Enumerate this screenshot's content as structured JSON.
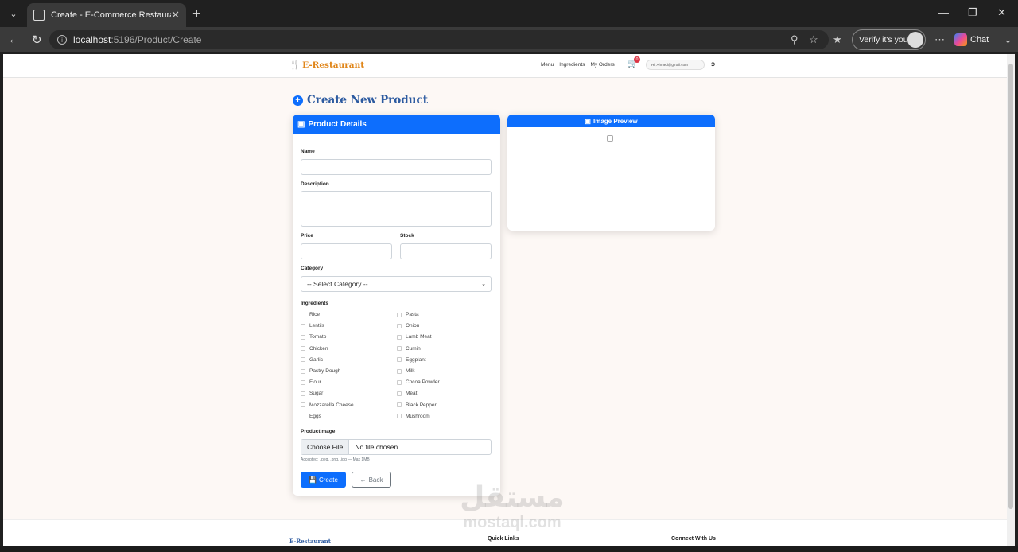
{
  "browser": {
    "tab_title": "Create - E-Commerce Restaurant",
    "url_host": "localhost",
    "url_path": ":5196/Product/Create",
    "verify_label": "Verify it's you",
    "chat_label": "Chat"
  },
  "site": {
    "brand": "E-Restaurant",
    "nav": {
      "menu": "Menu",
      "ingredients": "Ingredients",
      "orders": "My Orders"
    },
    "cart_count": "0",
    "user_greeting": "Hi, Ahmed@gmail.com"
  },
  "page": {
    "title": "Create New Product"
  },
  "form": {
    "header": "Product Details",
    "name_label": "Name",
    "description_label": "Description",
    "price_label": "Price",
    "stock_label": "Stock",
    "category_label": "Category",
    "category_selected": "-- Select Category --",
    "ingredients_label": "Ingredients",
    "ingredients": [
      "Rice",
      "Pasta",
      "Lentils",
      "Onion",
      "Tomato",
      "Lamb Meat",
      "Chicken",
      "Cumin",
      "Garlic",
      "Eggplant",
      "Pastry Dough",
      "Milk",
      "Flour",
      "Cocoa Powder",
      "Sugar",
      "Meat",
      "Mozzarella Cheese",
      "Black Pepper",
      "Eggs",
      "Mushroom"
    ],
    "image_label": "ProductImage",
    "file_button": "Choose File",
    "file_status": "No file chosen",
    "file_hint": "Accepted: .jpeg, .png, .jpg — Max 1MB",
    "create_label": "Create",
    "back_label": "Back"
  },
  "preview": {
    "header": "Image Preview"
  },
  "footer": {
    "brand": "E-Restaurant",
    "quick_links": "Quick Links",
    "connect": "Connect With Us"
  },
  "watermark": {
    "arabic": "مستقل",
    "latin": "mostaql.com"
  },
  "colors": {
    "primary": "#0d6efd",
    "brand": "#e0861a",
    "title": "#2c5aa0",
    "page_bg": "#fdf8f5"
  }
}
